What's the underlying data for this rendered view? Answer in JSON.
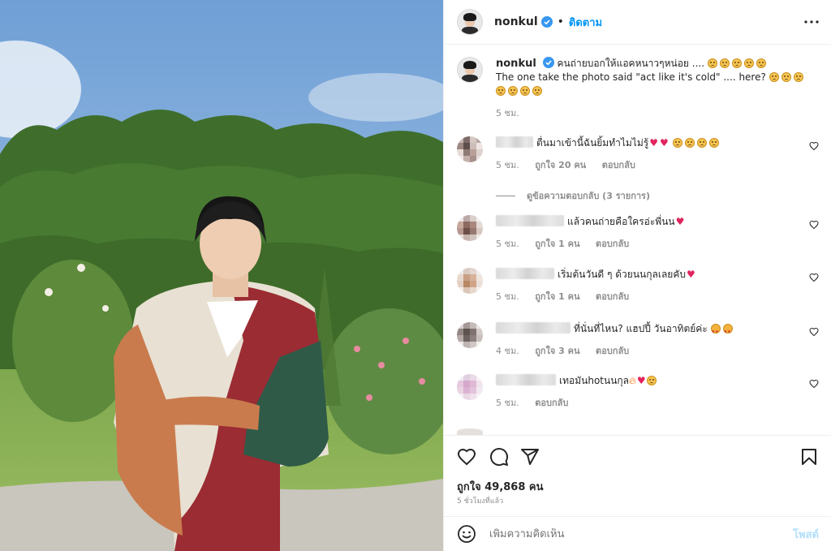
{
  "post": {
    "username": "nonkul",
    "follow_label": "ติดตาม",
    "dot": "•"
  },
  "caption": {
    "username": "nonkul",
    "text_th": "คนถ่ายบอกให้แอคหนาวๆหน่อย ....",
    "text_en": "The one take the photo said \"act like it's cold\" .... here?",
    "time": "5 ชม."
  },
  "comments": [
    {
      "text": "ตื่นมาเข้านี้ฉันยิ้มทำไมไม่รู้",
      "time": "5 ชม.",
      "likes": "ถูกใจ 20 คน",
      "reply": "ตอบกลับ"
    },
    {
      "text": "แล้วคนถ่ายคือใครอ่ะพี่นน",
      "time": "5 ชม.",
      "likes": "ถูกใจ 1 คน",
      "reply": "ตอบกลับ"
    },
    {
      "text": "เริ่มต้นวันดี ๆ ด้วยนนกุลเลยคับ",
      "time": "5 ชม.",
      "likes": "ถูกใจ 1 คน",
      "reply": "ตอบกลับ"
    },
    {
      "text": "ที่นั่นที่ไหน? แฮปปี้ วันอาทิตย์ค่ะ",
      "time": "4 ชม.",
      "likes": "ถูกใจ 3 คน",
      "reply": "ตอบกลับ"
    },
    {
      "text": "เทอมันhotนนกุล",
      "time": "5 ชม.",
      "likes": "",
      "reply": "ตอบกลับ"
    }
  ],
  "view_replies": "ดูข้อความตอบกลับ (3 รายการ)",
  "likes_total": "ถูกใจ 49,868 คน",
  "time_ago": "5 ชั่วโมงที่แล้ว",
  "add_comment": {
    "placeholder": "เพิ่มความคิดเห็น",
    "post_label": "โพสต์"
  },
  "colors": {
    "link_blue": "#0095f6",
    "post_disabled": "#b2dffc",
    "verified": "#3897f0",
    "heart_red": "#e0245e"
  },
  "icons": [
    "verified-badge-icon",
    "more-options-icon",
    "heart-icon",
    "comment-icon",
    "share-icon",
    "bookmark-icon",
    "emoji-icon"
  ]
}
